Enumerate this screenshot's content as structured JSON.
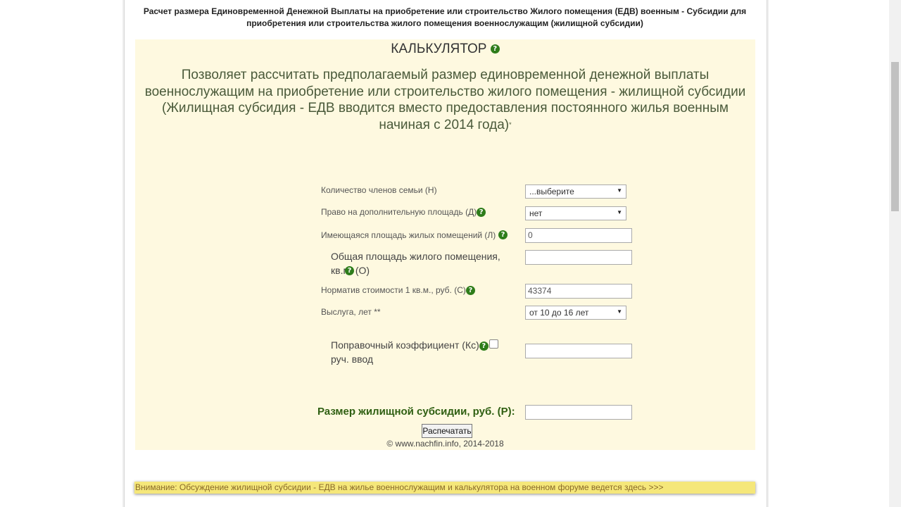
{
  "header": {
    "title": "Расчет размера Единовременной Денежной Выплаты на приобретение или строительство Жилого помещения (ЕДВ) военным - Субсидии для приобретения или строительства жилого помещения военнослужащим (жилищной субсидии)"
  },
  "calculator": {
    "heading": "КАЛЬКУЛЯТОР",
    "description_line1": "Позволяет рассчитать предполагаемый размер единовременной денежной выплаты военнослужащим на приобретение или строительство жилого помещения - жилищной субсидии",
    "description_line2": "(Жилищная субсидия - ЕДВ вводится вместо предоставления постоянного жилья военным начиная с 2014 года)",
    "description_asterisk": "*",
    "help_icon": "question-mark-icon",
    "help_color": "#2e7d1a"
  },
  "form": {
    "family_members": {
      "label": "Количество членов семьи (Н)",
      "value": "...выберите"
    },
    "extra_area": {
      "label": "Право на дополнительную площадь (Д)",
      "value": "нет"
    },
    "existing_area": {
      "label": "Имеющаяся площадь жилых помещений (Л)",
      "value": "0"
    },
    "total_area": {
      "label": "Общая площадь жилого помещения, кв.м. (О)",
      "value": ""
    },
    "cost_norm": {
      "label": "Норматив стоимости 1 кв.м., руб. (С)",
      "value": "43374"
    },
    "service_years": {
      "label": "Выслуга, лет **",
      "value": "от 10 до 16 лет"
    },
    "correction_coef": {
      "label_line1": "Поправочный коэффициент (Кс)",
      "label_line2": "руч. ввод",
      "value": ""
    },
    "result": {
      "label": "Размер жилищной субсидии, руб. (Р):",
      "value": ""
    },
    "print_button": "Распечатать"
  },
  "footer": {
    "copyright": "© www.nachfin.info, 2014-2018",
    "notice": "Внимание: Обсуждение жилищной субсидии - ЕДВ на жилье военнослужащим и калькулятора на военном форуме ведется здесь >>>"
  },
  "colors": {
    "calc_background": "#fef9e0",
    "notice_background": "#f5e77a",
    "result_label": "#2f5f12"
  }
}
